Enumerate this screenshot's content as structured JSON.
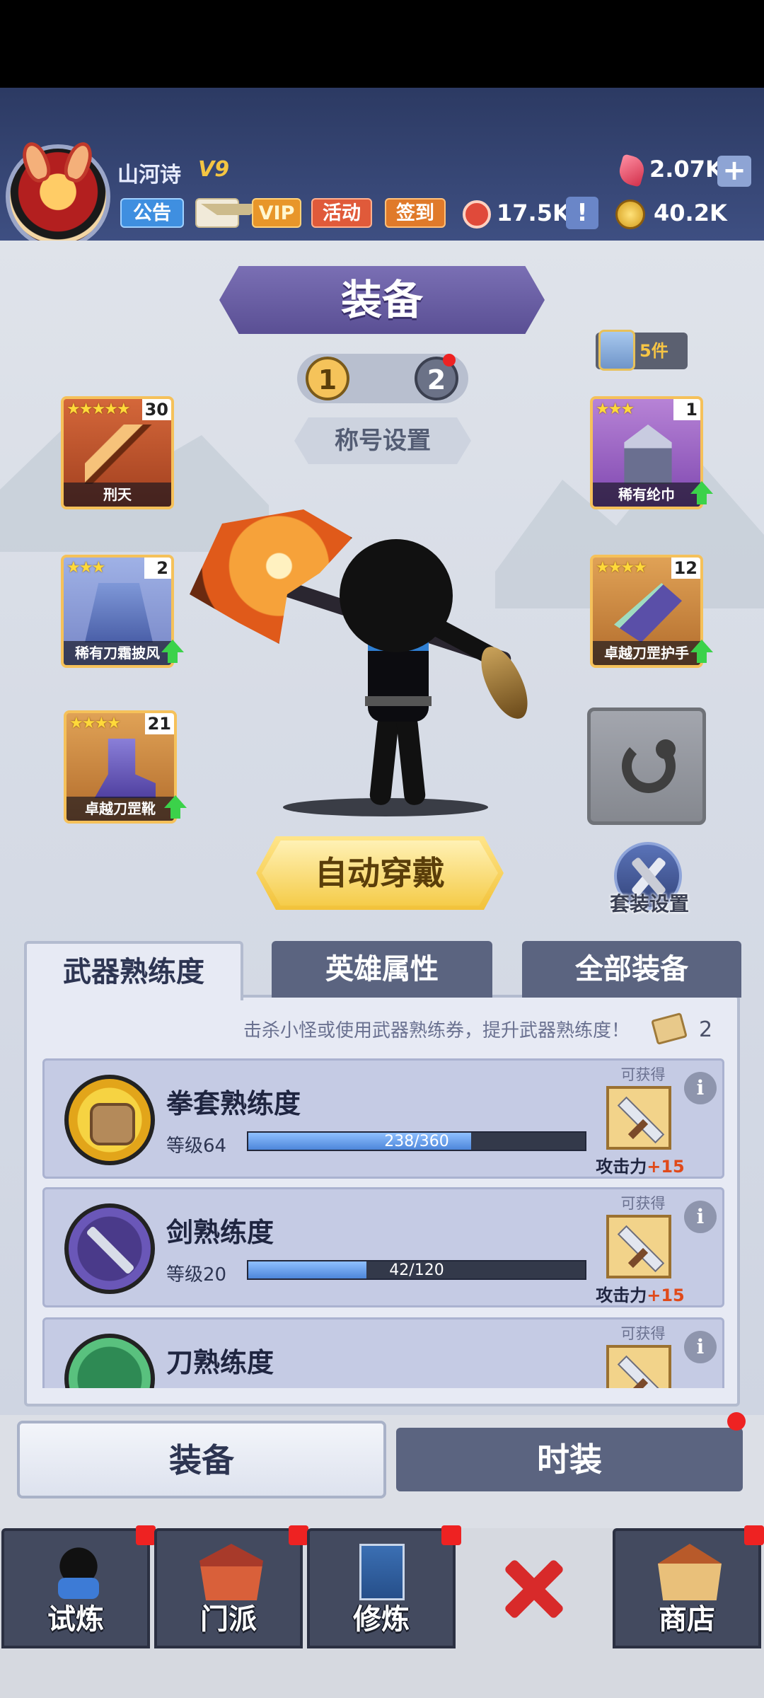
{
  "header": {
    "player_name": "山河诗",
    "vip_level": "V9",
    "buttons": {
      "notice": "公告",
      "vip": "VIP",
      "event": "活动",
      "signin": "签到"
    },
    "resources": {
      "gems": "2.07K",
      "tokens": "17.5K",
      "gold": "40.2K"
    }
  },
  "equipment": {
    "title": "装备",
    "pages": [
      "1",
      "2"
    ],
    "title_setting": "称号设置",
    "set_count": "5件",
    "slots": [
      {
        "name": "刑天",
        "level": "30",
        "stars": "★★★★★",
        "rarity": "orange",
        "upgrade": false
      },
      {
        "name": "稀有刀霜披风",
        "level": "2",
        "stars": "★★★",
        "rarity": "lpurple",
        "upgrade": true
      },
      {
        "name": "卓越刀罡靴",
        "level": "21",
        "stars": "★★★★",
        "rarity": "gold",
        "upgrade": true
      },
      {
        "name": "稀有纶巾",
        "level": "1",
        "stars": "★★★",
        "rarity": "purple",
        "upgrade": true
      },
      {
        "name": "卓越刀罡护手",
        "level": "12",
        "stars": "★★★★",
        "rarity": "gold",
        "upgrade": true
      }
    ],
    "auto_equip": "自动穿戴",
    "suit_setting": "套装设置"
  },
  "panel": {
    "tabs": [
      "武器熟练度",
      "英雄属性",
      "全部装备"
    ],
    "active_tab": "武器熟练度",
    "hint": "击杀小怪或使用武器熟练券，提升武器熟练度！",
    "ticket_count": "2",
    "masteries": [
      {
        "name": "拳套熟练度",
        "level_text": "等级64",
        "progress_text": "238/360",
        "progress": 0.661,
        "reward_label": "可获得",
        "reward_prefix": "攻击力",
        "reward_value": "+15"
      },
      {
        "name": "剑熟练度",
        "level_text": "等级20",
        "progress_text": "42/120",
        "progress": 0.35,
        "reward_label": "可获得",
        "reward_prefix": "攻击力",
        "reward_value": "+15"
      },
      {
        "name": "刀熟练度",
        "reward_label": "可获得"
      }
    ]
  },
  "bottom_tabs": {
    "equipment": "装备",
    "fashion": "时装"
  },
  "nav": {
    "trial": "试炼",
    "sect": "门派",
    "cultivate": "修炼",
    "shop": "商店"
  },
  "colors": {
    "header_bg": "#34446f",
    "accent_gold": "#f5c35a",
    "notification_red": "#ee2222",
    "panel_bg": "#e7eaf4"
  }
}
